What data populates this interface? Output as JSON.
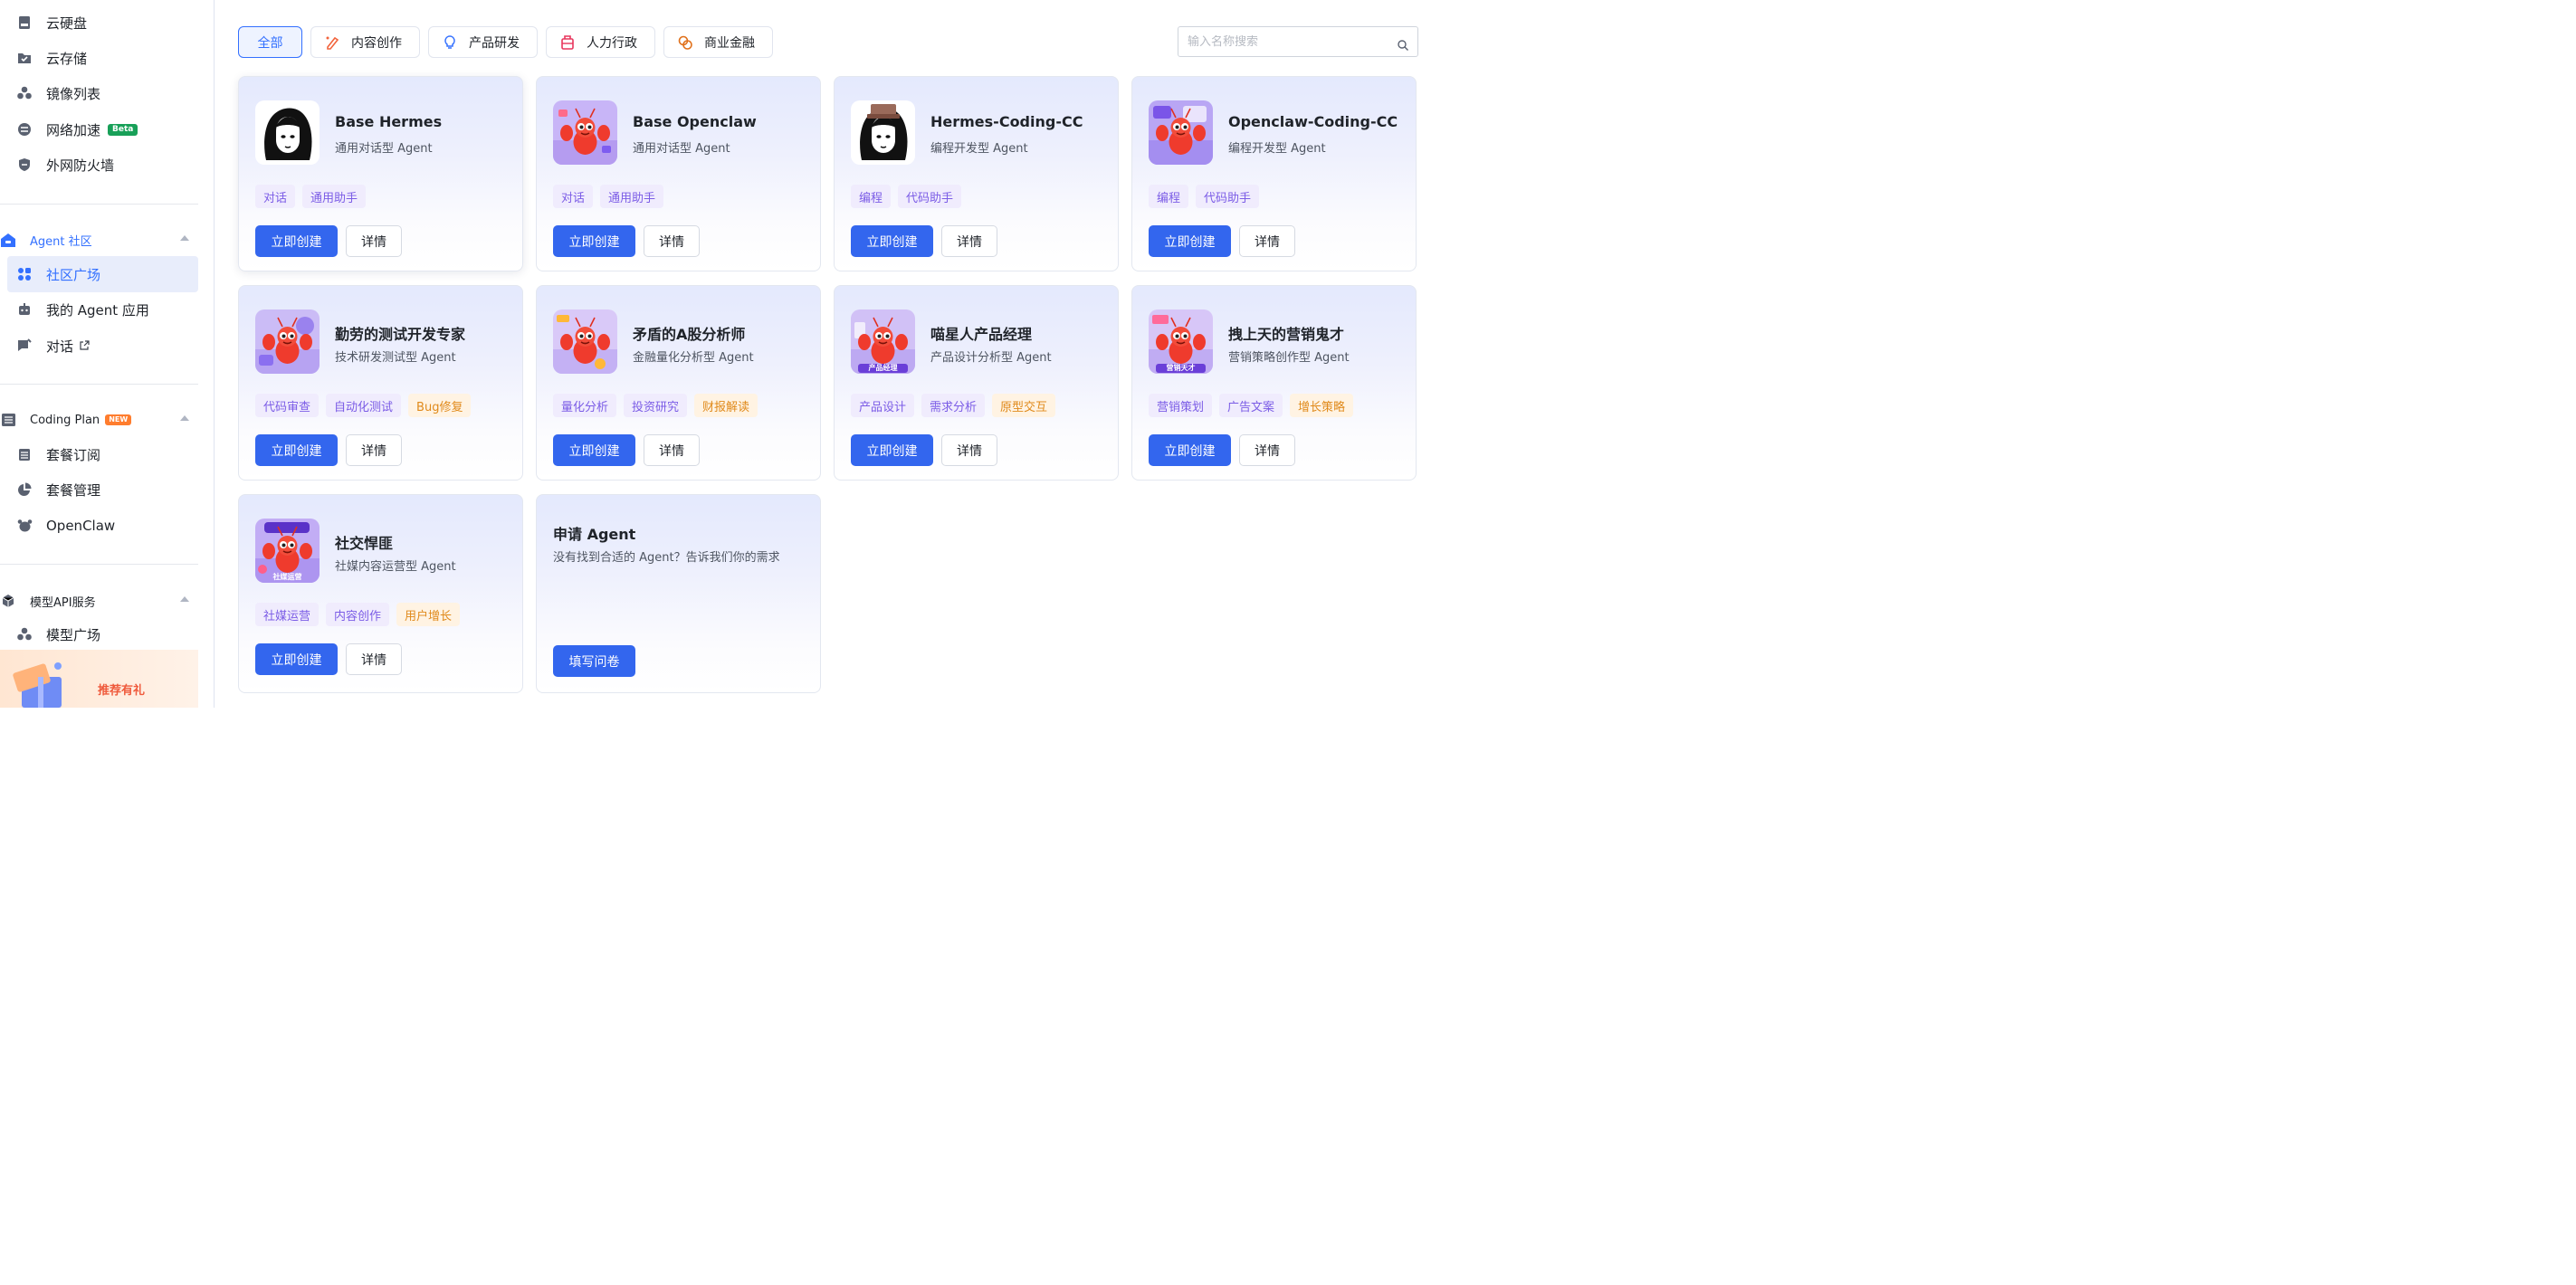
{
  "sidebar": {
    "items_top": [
      {
        "label": "云硬盘",
        "icon": "disk-icon"
      },
      {
        "label": "云存储",
        "icon": "folder-icon"
      },
      {
        "label": "镜像列表",
        "icon": "cubes-icon"
      },
      {
        "label": "网络加速",
        "icon": "network-icon",
        "badge": "Beta"
      },
      {
        "label": "外网防火墙",
        "icon": "shield-icon"
      }
    ],
    "agent_group": {
      "title": "Agent 社区",
      "items": [
        {
          "label": "社区广场",
          "icon": "grid-icon",
          "active": true
        },
        {
          "label": "我的 Agent 应用",
          "icon": "robot-icon"
        },
        {
          "label": "对话",
          "icon": "chat-icon"
        }
      ]
    },
    "coding_group": {
      "title": "Coding Plan",
      "badge": "NEW",
      "items": [
        {
          "label": "套餐订阅",
          "icon": "calendar-icon"
        },
        {
          "label": "套餐管理",
          "icon": "pie-chart-icon"
        },
        {
          "label": "OpenClaw",
          "icon": "claw-icon"
        }
      ]
    },
    "model_group": {
      "title": "模型API服务",
      "items": [
        {
          "label": "模型广场",
          "icon": "cubes-icon"
        }
      ]
    },
    "promo": {
      "text": "推荐有礼"
    }
  },
  "filters": [
    {
      "label": "全部",
      "active": true
    },
    {
      "label": "内容创作",
      "icon": "pen-icon",
      "color": "#f2643c"
    },
    {
      "label": "产品研发",
      "icon": "bulb-icon",
      "color": "#3370ff"
    },
    {
      "label": "人力行政",
      "icon": "briefcase-icon",
      "color": "#e8365d"
    },
    {
      "label": "商业金融",
      "icon": "coins-icon",
      "color": "#e0701a"
    }
  ],
  "search": {
    "placeholder": "输入名称搜索"
  },
  "agents": [
    {
      "name": "Base Hermes",
      "type": "通用对话型 Agent",
      "tags": [
        {
          "t": "对话",
          "c": "p"
        },
        {
          "t": "通用助手",
          "c": "p"
        }
      ],
      "avatar": "hermes"
    },
    {
      "name": "Base Openclaw",
      "type": "通用对话型 Agent",
      "tags": [
        {
          "t": "对话",
          "c": "p"
        },
        {
          "t": "通用助手",
          "c": "p"
        }
      ],
      "avatar": "lobster"
    },
    {
      "name": "Hermes-Coding-CC",
      "type": "编程开发型 Agent",
      "tags": [
        {
          "t": "编程",
          "c": "p"
        },
        {
          "t": "代码助手",
          "c": "p"
        }
      ],
      "avatar": "hermes-hat"
    },
    {
      "name": "Openclaw-Coding-CC",
      "type": "编程开发型 Agent",
      "tags": [
        {
          "t": "编程",
          "c": "p"
        },
        {
          "t": "代码助手",
          "c": "p"
        }
      ],
      "avatar": "lobster-code"
    },
    {
      "name": "勤劳的测试开发专家",
      "type": "技术研发测试型 Agent",
      "tags": [
        {
          "t": "代码审查",
          "c": "p"
        },
        {
          "t": "自动化测试",
          "c": "p"
        },
        {
          "t": "Bug修复",
          "c": "o"
        }
      ],
      "avatar": "lobster-test"
    },
    {
      "name": "矛盾的A股分析师",
      "type": "金融量化分析型 Agent",
      "tags": [
        {
          "t": "量化分析",
          "c": "p"
        },
        {
          "t": "投资研究",
          "c": "p"
        },
        {
          "t": "财报解读",
          "c": "o"
        }
      ],
      "avatar": "lobster-stock"
    },
    {
      "name": "喵星人产品经理",
      "type": "产品设计分析型 Agent",
      "tags": [
        {
          "t": "产品设计",
          "c": "p"
        },
        {
          "t": "需求分析",
          "c": "p"
        },
        {
          "t": "原型交互",
          "c": "o"
        }
      ],
      "avatar": "lobster-pm",
      "avatar_text": "产品经理"
    },
    {
      "name": "拽上天的营销鬼才",
      "type": "营销策略创作型 Agent",
      "tags": [
        {
          "t": "营销策划",
          "c": "p"
        },
        {
          "t": "广告文案",
          "c": "p"
        },
        {
          "t": "增长策略",
          "c": "o"
        }
      ],
      "avatar": "lobster-mkt",
      "avatar_text": "营销天才"
    },
    {
      "name": "社交悍匪",
      "type": "社媒内容运营型 Agent",
      "tags": [
        {
          "t": "社媒运营",
          "c": "p"
        },
        {
          "t": "内容创作",
          "c": "p"
        },
        {
          "t": "用户增长",
          "c": "o"
        }
      ],
      "avatar": "lobster-social",
      "avatar_text": "社媒运营"
    }
  ],
  "card_actions": {
    "create": "立即创建",
    "detail": "详情"
  },
  "apply": {
    "title": "申请 Agent",
    "subtitle": "没有找到合适的 Agent？告诉我们你的需求",
    "button": "填写问卷"
  },
  "colors": {
    "primary": "#3366ee",
    "accent": "#3370ff",
    "tag_purple": "#7b5ce6",
    "tag_orange": "#e08a1b"
  }
}
